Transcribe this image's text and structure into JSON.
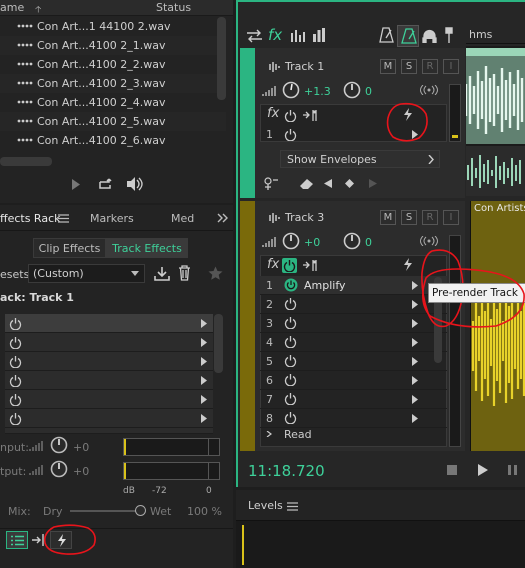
{
  "files": {
    "col_name": "ame",
    "col_status": "Status",
    "items": [
      "Con Art...1 44100 2.wav",
      "Con Art...4100 2_1.wav",
      "Con Art...4100 2_2.wav",
      "Con Art...4100 2_3.wav",
      "Con Art...4100 2_4.wav",
      "Con Art...4100 2_5.wav",
      "Con Art...4100 2_6.wav"
    ]
  },
  "rack": {
    "tabs": [
      "ffects Rack",
      "Markers",
      "Med"
    ],
    "subtabs": [
      "Clip Effects",
      "Track Effects"
    ],
    "presets_label": "esets:",
    "presets_value": "(Custom)",
    "track_label": "ack: Track 1",
    "input_label": "nput:",
    "output_label": "tput:",
    "input_value": "+0",
    "output_value": "+0",
    "meter_scale": [
      "dB",
      "-72",
      "0"
    ],
    "mix_label": "Mix:",
    "dry_label": "Dry",
    "wet_label": "Wet",
    "wet_value": "100 %"
  },
  "editor": {
    "ruler_label": "hms",
    "track1": {
      "name": "Track 1",
      "volume": "+1.3",
      "pan": "0",
      "slot_num": "1",
      "show_envelopes": "Show Envelopes"
    },
    "track3": {
      "name": "Track 3",
      "volume": "+0",
      "pan": "0",
      "slot_nums": [
        "1",
        "2",
        "3",
        "4",
        "5",
        "6",
        "7",
        "8"
      ],
      "slot1_effect": "Amplify",
      "read_mode": "Read",
      "clip_title": "Con Artists -"
    },
    "msri": [
      "M",
      "S",
      "R",
      "I"
    ],
    "fx_label": "fx",
    "tooltip": "Pre-render Track",
    "timecode": "11:18.720"
  },
  "levels": {
    "title": "Levels"
  },
  "colors": {
    "accent": "#2bb582",
    "track1": "#2bb582",
    "track3": "#7a6a0a",
    "waveform_green": "#9bd6b8",
    "waveform_yellow": "#d9c21a",
    "annotation": "#e8141b",
    "timecode": "#3ed19a"
  }
}
